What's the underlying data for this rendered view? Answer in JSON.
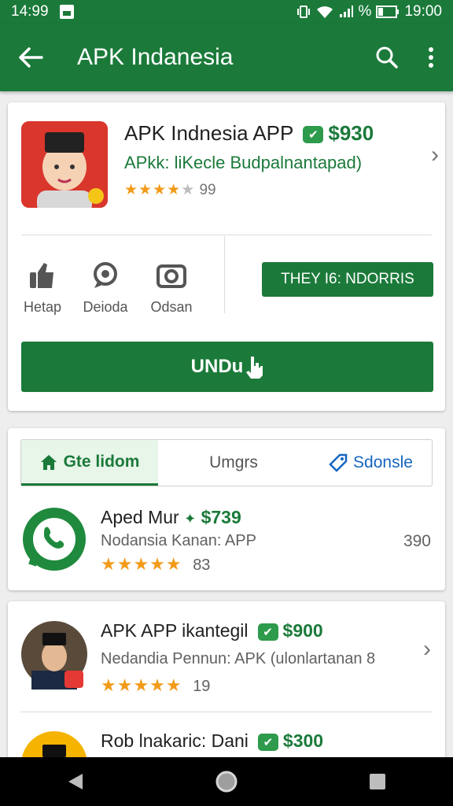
{
  "status_bar": {
    "time_left": "14:99",
    "battery_text": "%",
    "time_right": "19:00"
  },
  "app_bar": {
    "title": "APK Indanesia",
    "icons": [
      "back-arrow-icon",
      "search-icon",
      "more-vert-icon"
    ]
  },
  "hero": {
    "title": "APK Indnesia APP",
    "price": "$930",
    "subtitle": "APkk: liKecle Budpalnantapad)",
    "rating": 3.5,
    "rating_count": "99",
    "actions": [
      {
        "label": "Hetap",
        "icon": "thumb-icon"
      },
      {
        "label": "Deioda",
        "icon": "chat-icon"
      },
      {
        "label": "Odsan",
        "icon": "camera-icon"
      }
    ],
    "secondary_button": "THEY I6: NDORRIS",
    "primary_button": "UNDu"
  },
  "tabs": [
    {
      "label": "Gte lidom",
      "icon": "home-icon",
      "active": true
    },
    {
      "label": "Umgrs",
      "active": false
    },
    {
      "label": "Sdonsle",
      "icon": "tag-icon",
      "active": false
    }
  ],
  "list_items": [
    {
      "title": "Aped Mur",
      "price": "$739",
      "subtitle": "Nodansia Kanan: APP",
      "rating": 4.5,
      "rating_count": "83",
      "count": "390",
      "icon": "whatsapp-icon"
    },
    {
      "title": "APK APP ikantegil",
      "price": "$900",
      "subtitle": "Nedandia Pennun: APK (ulonlartanan 8",
      "rating": 4.5,
      "rating_count": "19",
      "icon": "avatar-icon"
    },
    {
      "title": "Rob lnakaric: Dani",
      "price": "$300",
      "icon": "avatar-icon"
    }
  ],
  "colors": {
    "primary": "#1b7a3a",
    "accent_star": "#f29b1a",
    "link_blue": "#1565c0"
  }
}
